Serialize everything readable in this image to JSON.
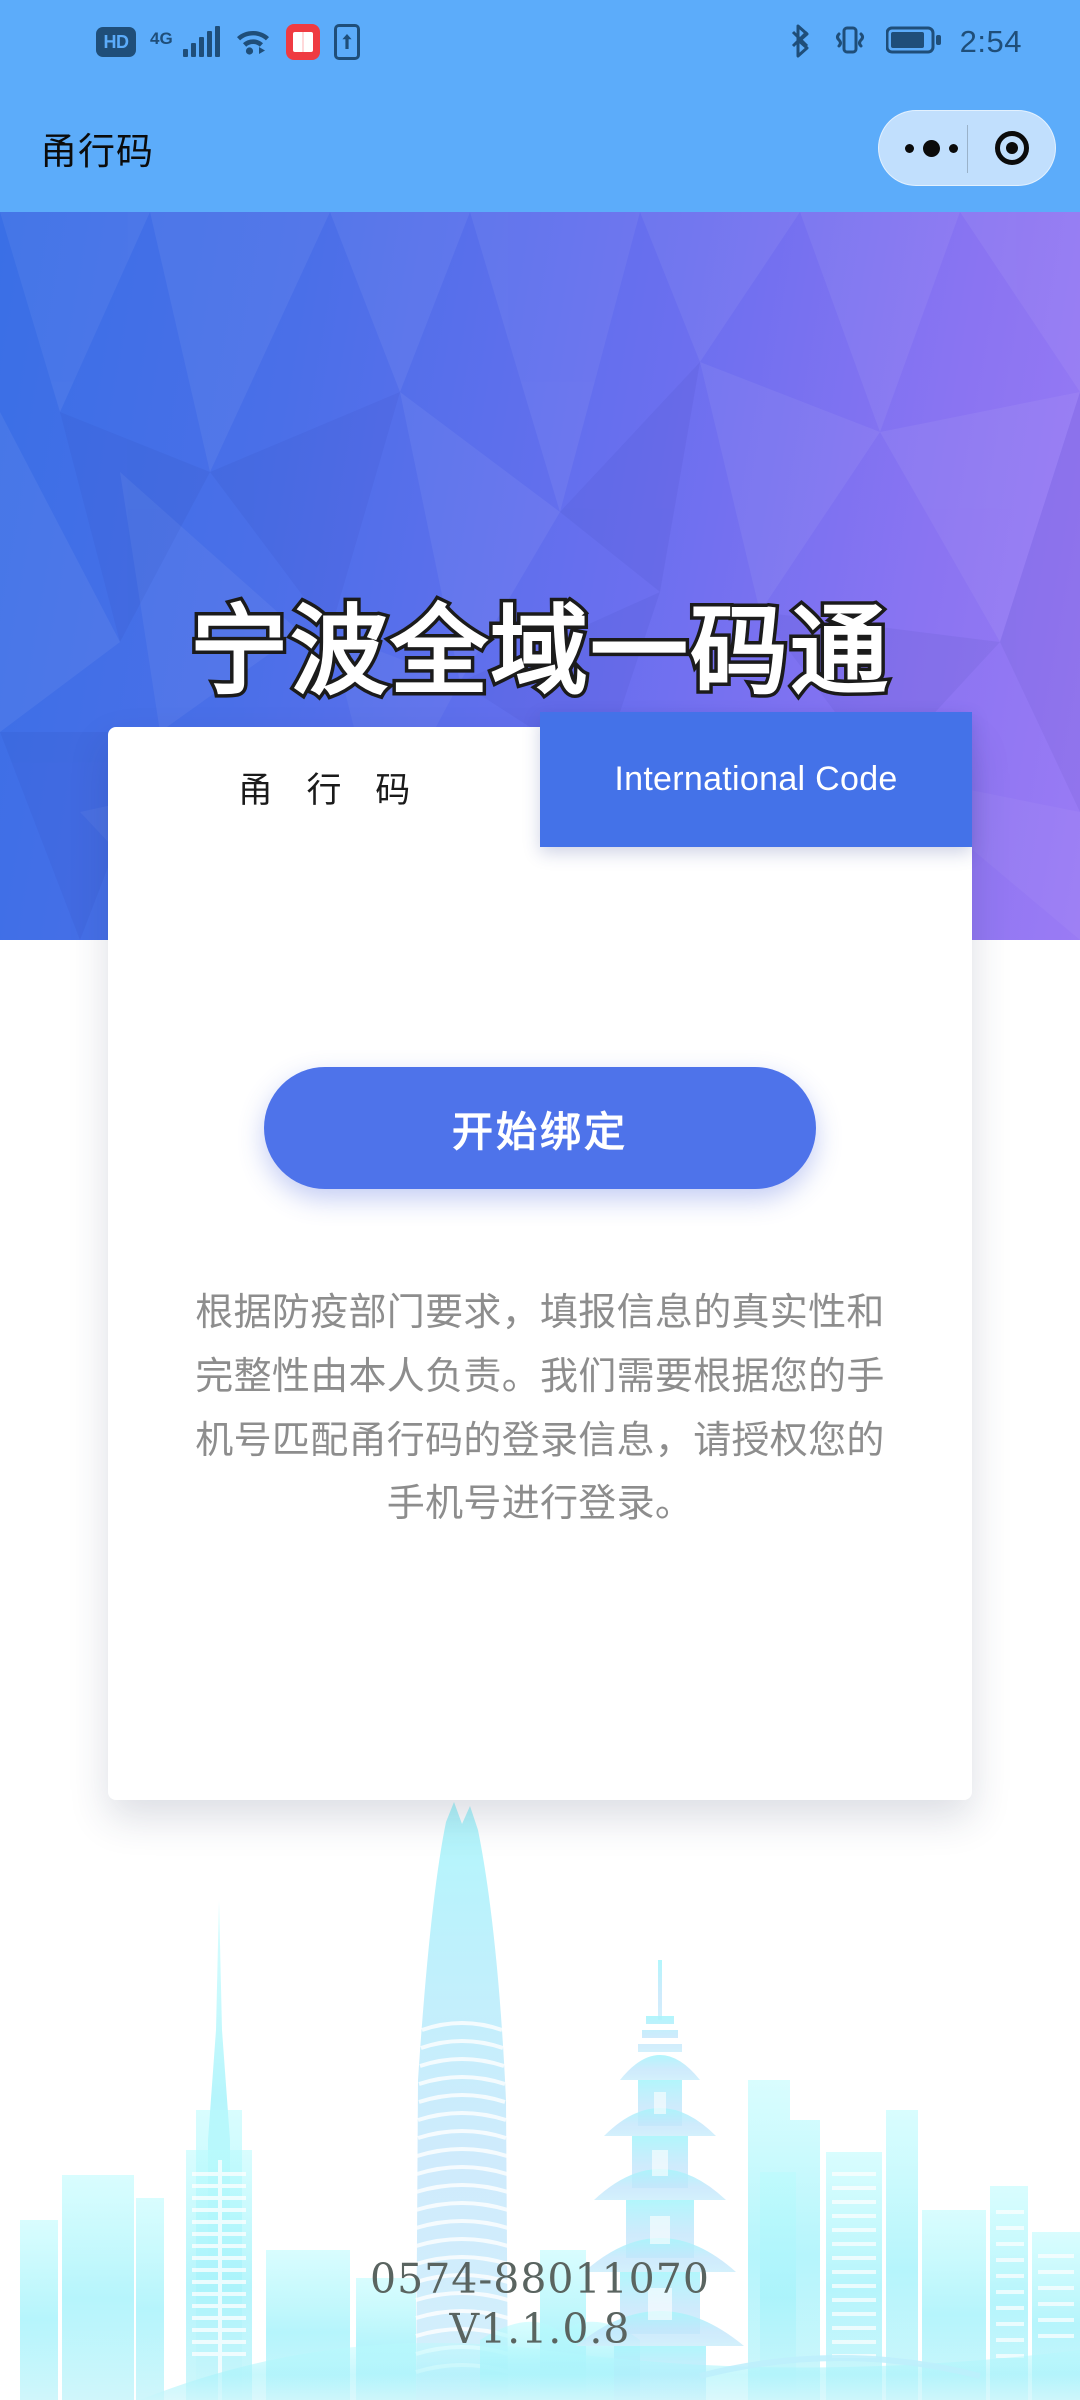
{
  "status_bar": {
    "hd_label": "HD",
    "network_label": "4G",
    "signal_icon": "signal-bars-icon",
    "wifi_icon": "wifi-icon",
    "book_app_icon": "book-app-icon",
    "cast_icon": "screen-cast-icon",
    "bluetooth_icon": "bluetooth-icon",
    "vibrate_icon": "vibrate-mode-icon",
    "battery_icon": "battery-icon",
    "time": "2:54",
    "ink_color": "#1f4e79",
    "background": "#5cacfa"
  },
  "nav_bar": {
    "title": "甬行码",
    "capsule": {
      "more_icon": "more-dots-icon",
      "target_icon": "target-circle-icon"
    }
  },
  "hero": {
    "title": "宁波全域一码通",
    "gradient_from": "#3a6fe6",
    "gradient_to": "#9a7bf4"
  },
  "card": {
    "tabs": [
      {
        "label": "甬 行 码",
        "active": true,
        "name": "tab-local-code"
      },
      {
        "label": "International Code",
        "active": false,
        "name": "tab-international-code"
      }
    ],
    "bind_button_label": "开始绑定",
    "notice": "根据防疫部门要求，填报信息的真实性和完整性由本人负责。我们需要根据您的手机号匹配甬行码的登录信息，请授权您的手机号进行登录。",
    "accent_color": "#4e73ea",
    "tab_active_color": "#4472e8"
  },
  "footer": {
    "phone": "0574-88011070",
    "version": "V1.1.0.8"
  },
  "skyline": {
    "icon": "city-skyline-illustration",
    "color": "#9ff2f7"
  }
}
